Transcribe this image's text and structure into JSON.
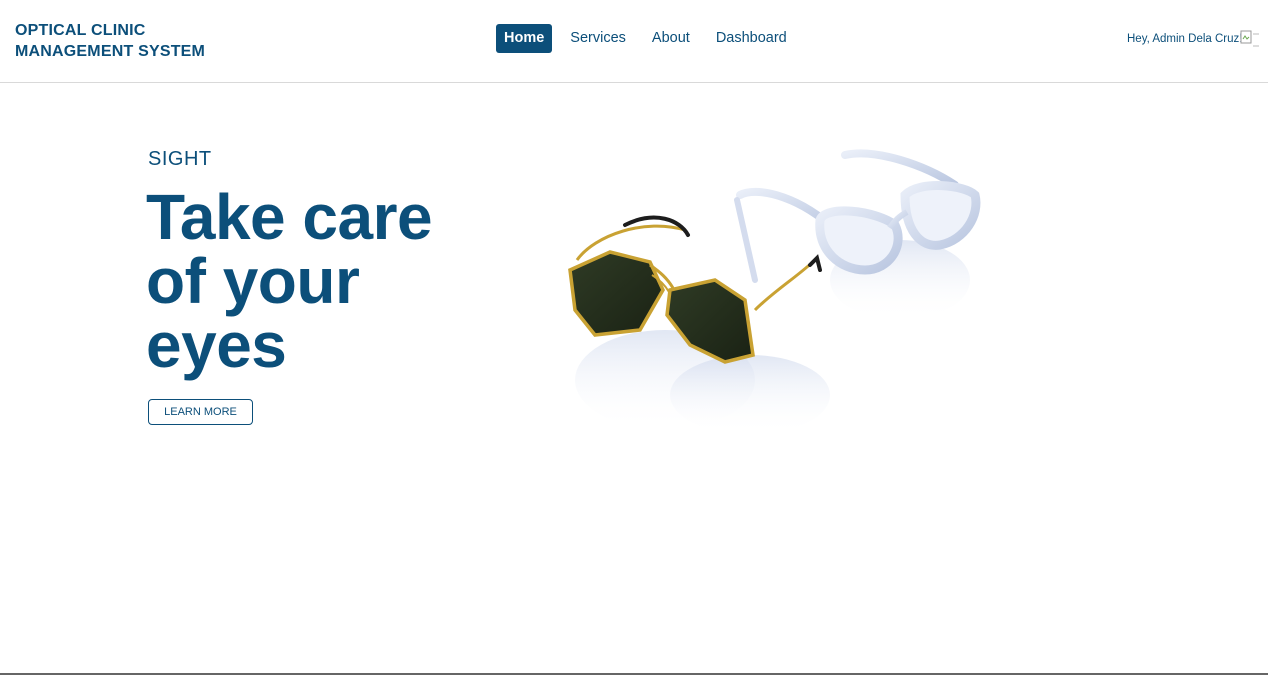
{
  "brand": {
    "line1": "OPTICAL CLINIC",
    "line2": "MANAGEMENT SYSTEM"
  },
  "nav": {
    "items": [
      {
        "label": "Home",
        "active": true
      },
      {
        "label": "Services",
        "active": false
      },
      {
        "label": "About",
        "active": false
      },
      {
        "label": "Dashboard",
        "active": false
      }
    ]
  },
  "user": {
    "greeting": "Hey, Admin Dela Cruz!"
  },
  "hero": {
    "eyebrow": "SIGHT",
    "headline": "Take care of your eyes",
    "cta_label": "LEARN MORE"
  },
  "colors": {
    "primary": "#0c4f7a",
    "background": "#ffffff"
  }
}
